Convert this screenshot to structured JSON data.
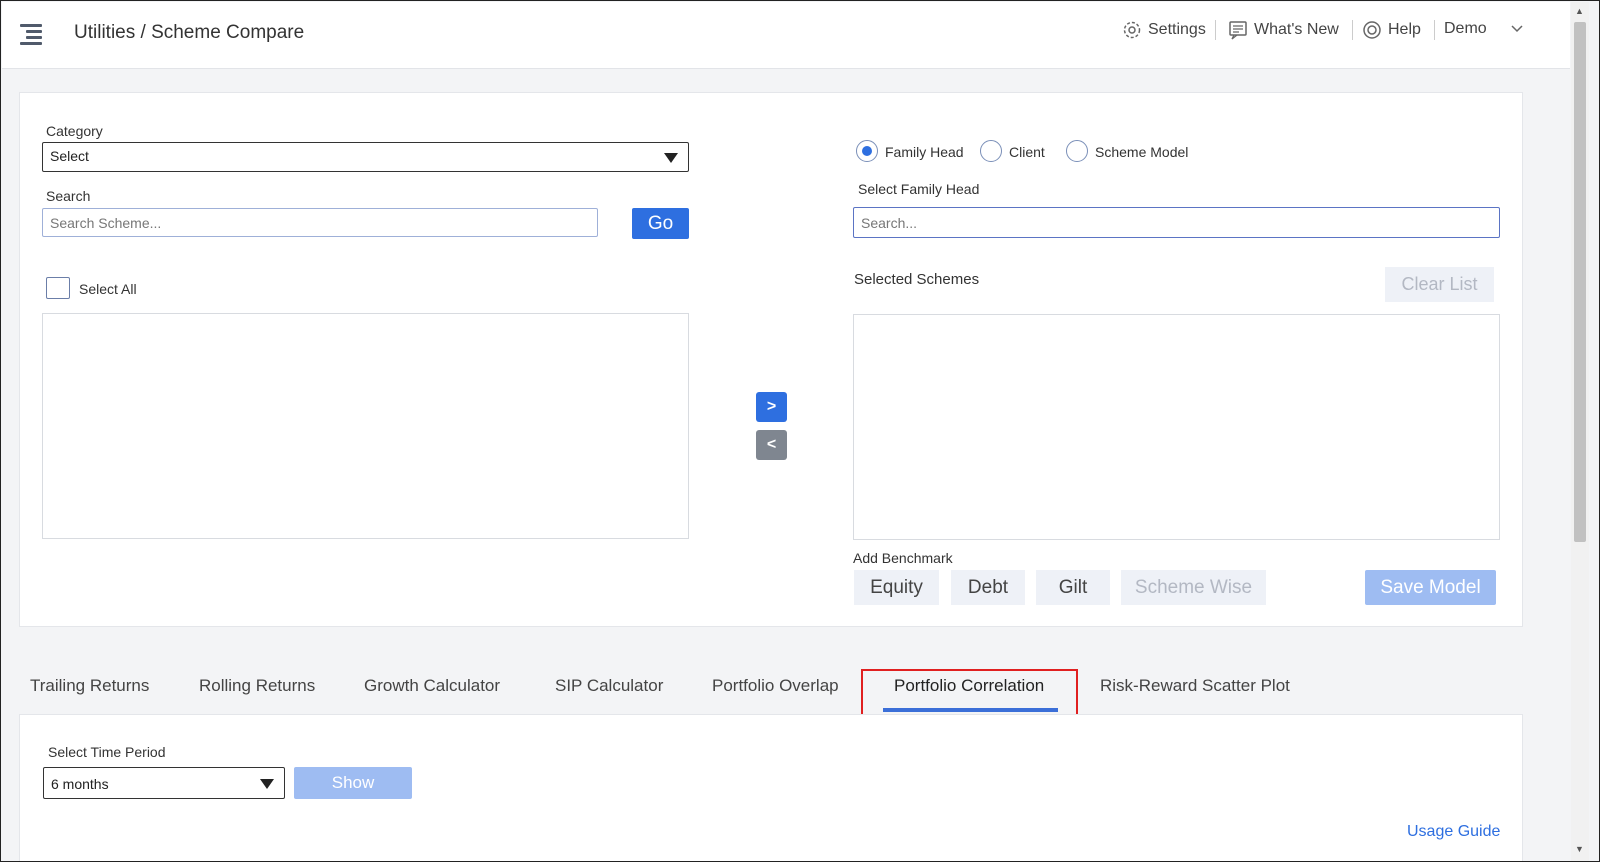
{
  "header": {
    "breadcrumb": "Utilities / Scheme Compare",
    "settings": "Settings",
    "whats_new": "What's New",
    "help": "Help",
    "user": "Demo"
  },
  "left": {
    "category_label": "Category",
    "category_value": "Select",
    "search_label": "Search",
    "search_placeholder": "Search Scheme...",
    "go": "Go",
    "select_all": "Select All"
  },
  "transfer": {
    "add": ">",
    "remove": "<"
  },
  "right": {
    "radios": [
      {
        "label": "Family Head",
        "checked": true
      },
      {
        "label": "Client",
        "checked": false
      },
      {
        "label": "Scheme Model",
        "checked": false
      }
    ],
    "select_label": "Select Family Head",
    "search_placeholder": "Search...",
    "selected_schemes": "Selected Schemes",
    "clear_list": "Clear List",
    "add_benchmark": "Add Benchmark",
    "benchmarks": [
      "Equity",
      "Debt",
      "Gilt",
      "Scheme Wise"
    ],
    "save_model": "Save Model"
  },
  "tabs": [
    "Trailing Returns",
    "Rolling Returns",
    "Growth Calculator",
    "SIP Calculator",
    "Portfolio Overlap",
    "Portfolio Correlation",
    "Risk-Reward Scatter Plot"
  ],
  "active_tab": "Portfolio Correlation",
  "bottom": {
    "time_period_label": "Select Time Period",
    "time_period_value": "6 months",
    "show": "Show",
    "usage_guide": "Usage Guide"
  },
  "colors": {
    "primary": "#2e6fe0",
    "highlight": "#e02020",
    "muted_button": "#9ebcf2"
  }
}
